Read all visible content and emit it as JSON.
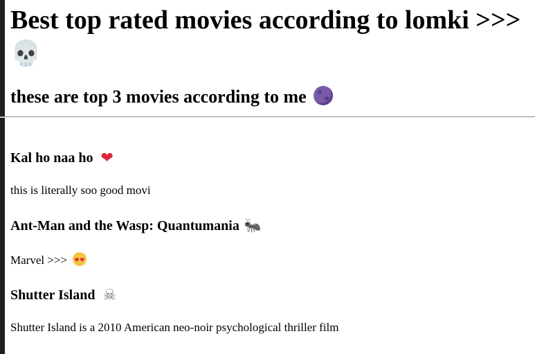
{
  "header": {
    "title": "Best top rated movies according to lomki >>>",
    "title_icon": "skull-emoji",
    "subtitle": "these are top 3 movies according to me",
    "subtitle_icon": "moon-face-emoji"
  },
  "movies": [
    {
      "title": "Kal ho naa ho",
      "icon": "heart-emoji",
      "description": "this is literally soo good movi"
    },
    {
      "title": "Ant-Man and the Wasp: Quantumania",
      "icon": "ant-emoji",
      "description": "Marvel >>>",
      "description_icon": "heart-eyes-emoji"
    },
    {
      "title": "Shutter Island",
      "icon": "skull-crossbones-emoji",
      "description": "Shutter Island is a 2010 American neo-noir psychological thriller film"
    }
  ],
  "colors": {
    "text": "#000000",
    "heart": "#e0263a",
    "moon": "#7a5aa8",
    "ant": "#5b4f8a",
    "left_edge": "#202020"
  }
}
